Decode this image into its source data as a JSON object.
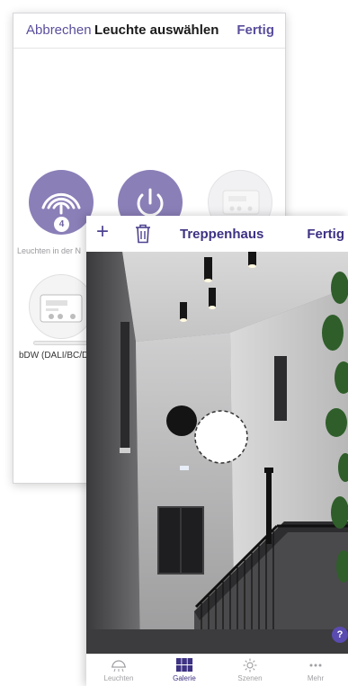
{
  "back_screen": {
    "cancel_label": "Abbrechen",
    "title": "Leuchte auswählen",
    "done_label": "Fertig",
    "group_item": {
      "badge_count": "4",
      "label": "Leuchten in der N"
    },
    "device_item": {
      "label": "bDW (DALI/BC/D"
    }
  },
  "front_screen": {
    "title": "Treppenhaus",
    "done_label": "Fertig",
    "add_icon": "+",
    "tabs": [
      {
        "label": "Leuchten",
        "icon": "lamp-icon"
      },
      {
        "label": "Galerie",
        "icon": "grid-icon"
      },
      {
        "label": "Szenen",
        "icon": "sun-icon"
      },
      {
        "label": "Mehr",
        "icon": "more-icon"
      }
    ],
    "help_label": "?"
  },
  "colors": {
    "accent": "#3d3283",
    "accent_light": "#8b7fb8",
    "help_button": "#5a4bb0"
  }
}
